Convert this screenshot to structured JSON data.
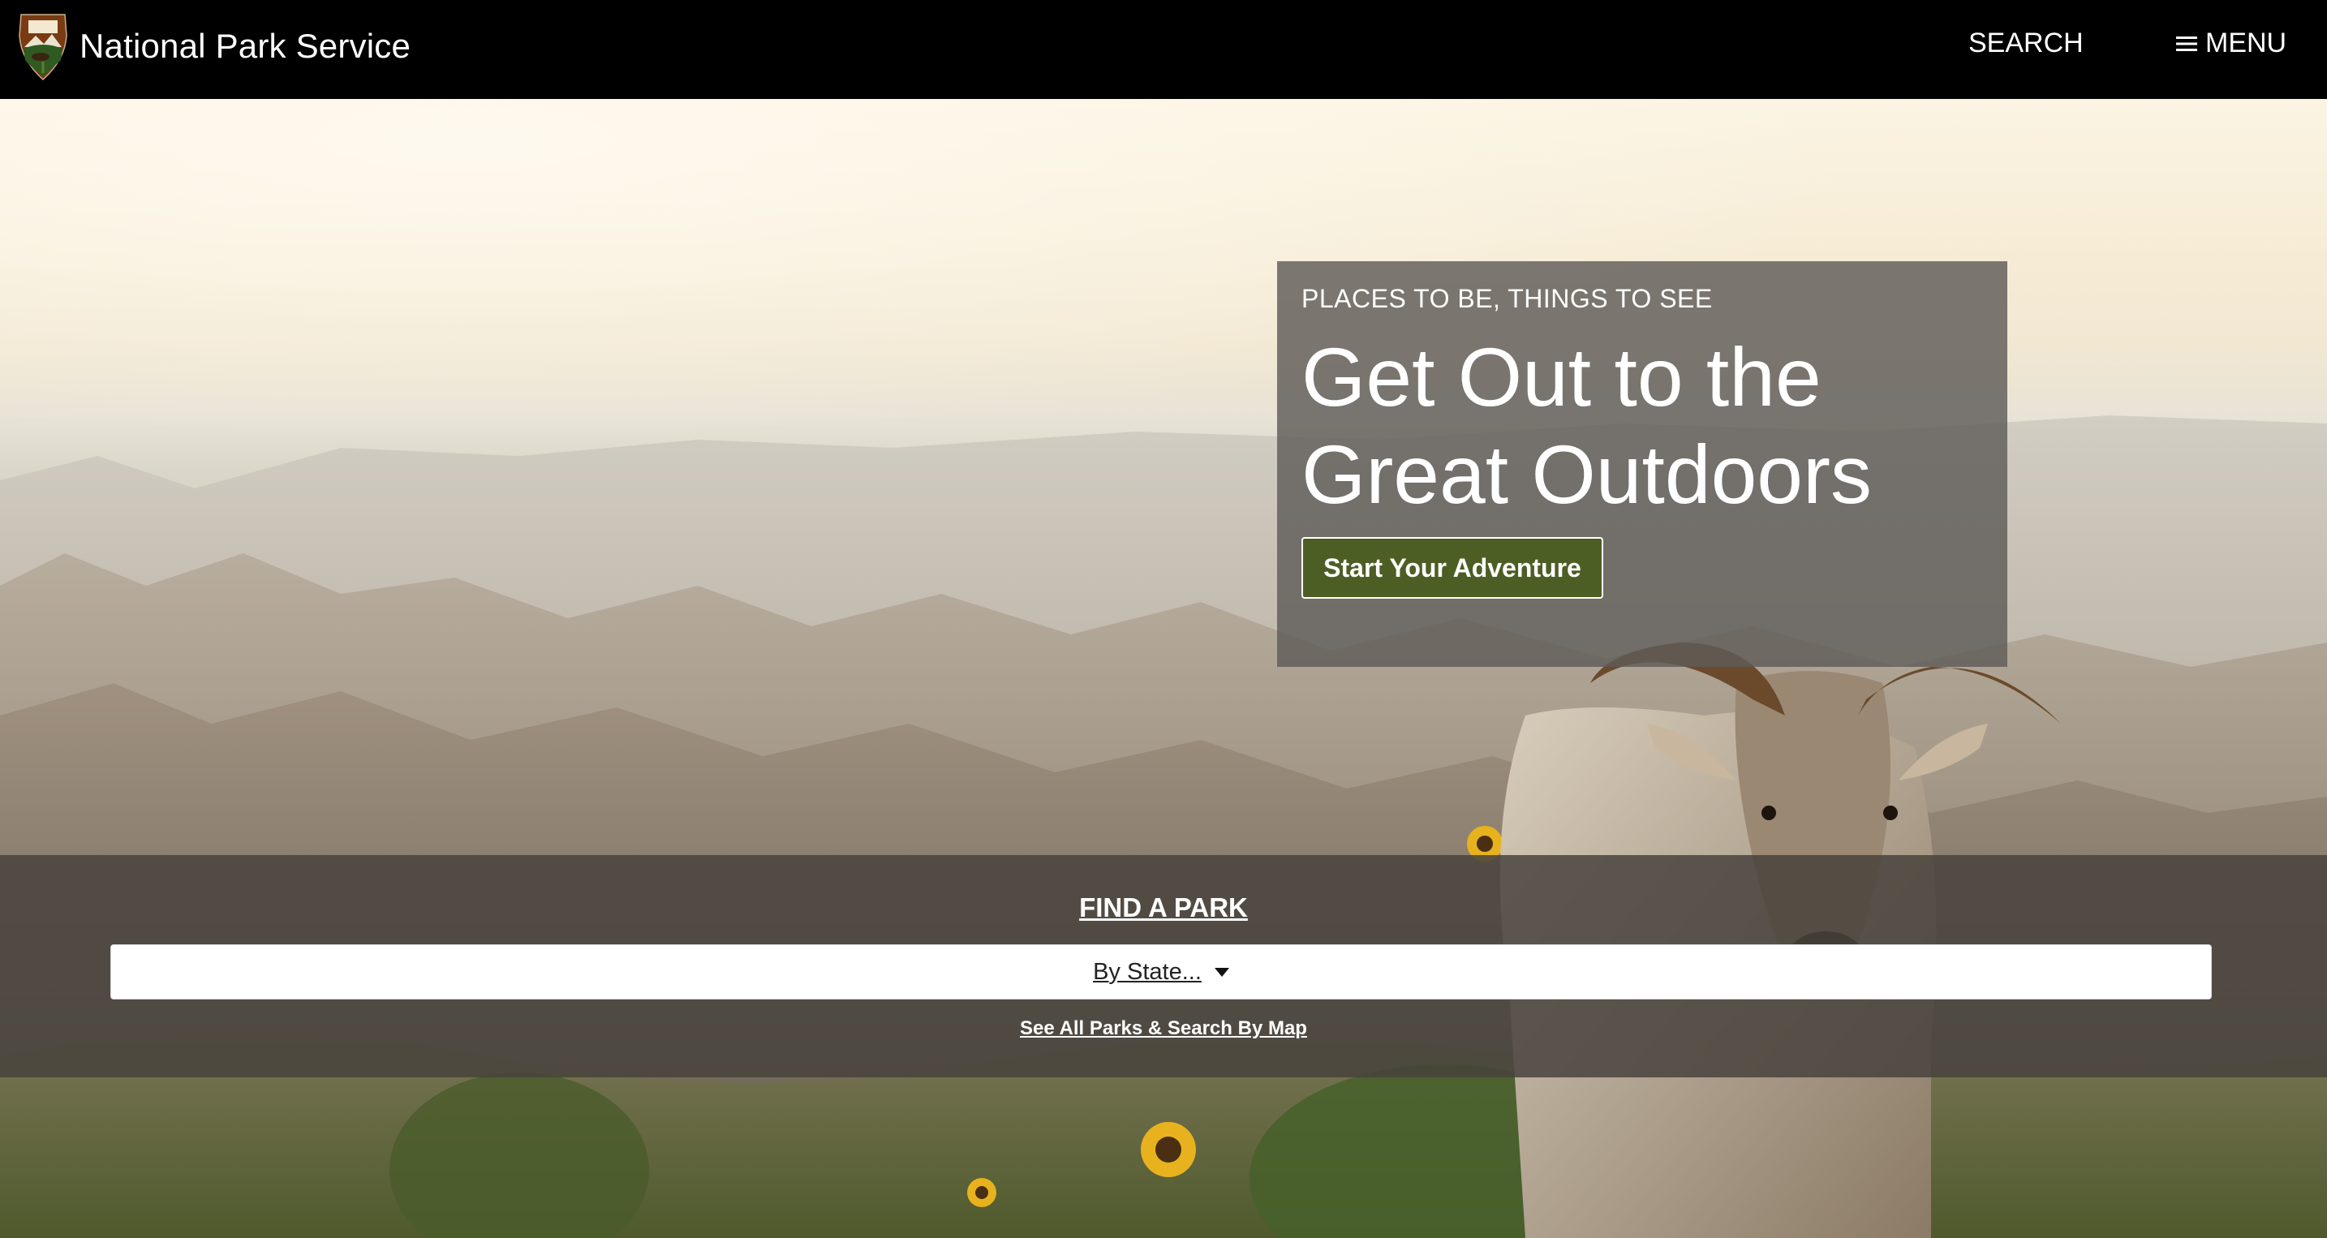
{
  "header": {
    "site_name": "National Park Service",
    "search_label": "SEARCH",
    "menu_label": "MENU",
    "logo_icon": "nps-arrowhead-icon",
    "menu_icon": "hamburger-icon"
  },
  "hero": {
    "image_subject": "bighorn-sheep-badlands-photo",
    "card": {
      "eyebrow": "PLACES TO BE, THINGS TO SEE",
      "headline": "Get Out to the Great Outdoors",
      "button_label": "Start Your Adventure"
    }
  },
  "find_park": {
    "title": "FIND A PARK",
    "select_label": "By State...",
    "select_icon": "caret-down-icon",
    "see_all_link": "See All Parks & Search By Map"
  },
  "colors": {
    "header_bg": "#000000",
    "button_green": "#4d5e24",
    "card_overlay": "#5f5c58",
    "band_overlay": "#46423c",
    "text_light": "#ffffff"
  }
}
